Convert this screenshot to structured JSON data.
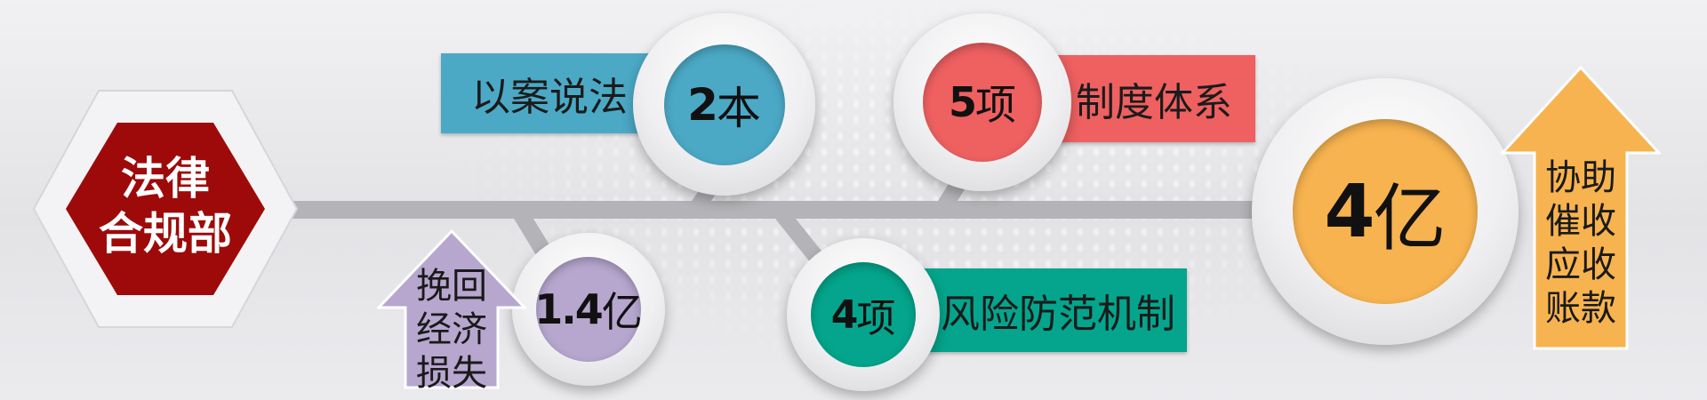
{
  "department": {
    "line1": "法律",
    "line2": "合规部"
  },
  "items": [
    {
      "label": "以案说法",
      "value": "2",
      "unit": "本"
    },
    {
      "label": "制度体系",
      "value": "5",
      "unit": "项"
    },
    {
      "label": "风险防范机制",
      "value": "4",
      "unit": "项"
    },
    {
      "lines": [
        "挽回",
        "经济",
        "损失"
      ],
      "value": "1.4",
      "unit": "亿"
    },
    {
      "lines": [
        "协助",
        "催收",
        "应收",
        "账款"
      ],
      "value": "4",
      "unit": "亿"
    }
  ],
  "colors": {
    "hexagon": "#9e0a0a",
    "blue": "#4ba9c6",
    "red": "#ef6061",
    "teal": "#04a58c",
    "purple": "#b7a7cf",
    "orange": "#f7b34f",
    "timeline": "#b4b4b8"
  }
}
